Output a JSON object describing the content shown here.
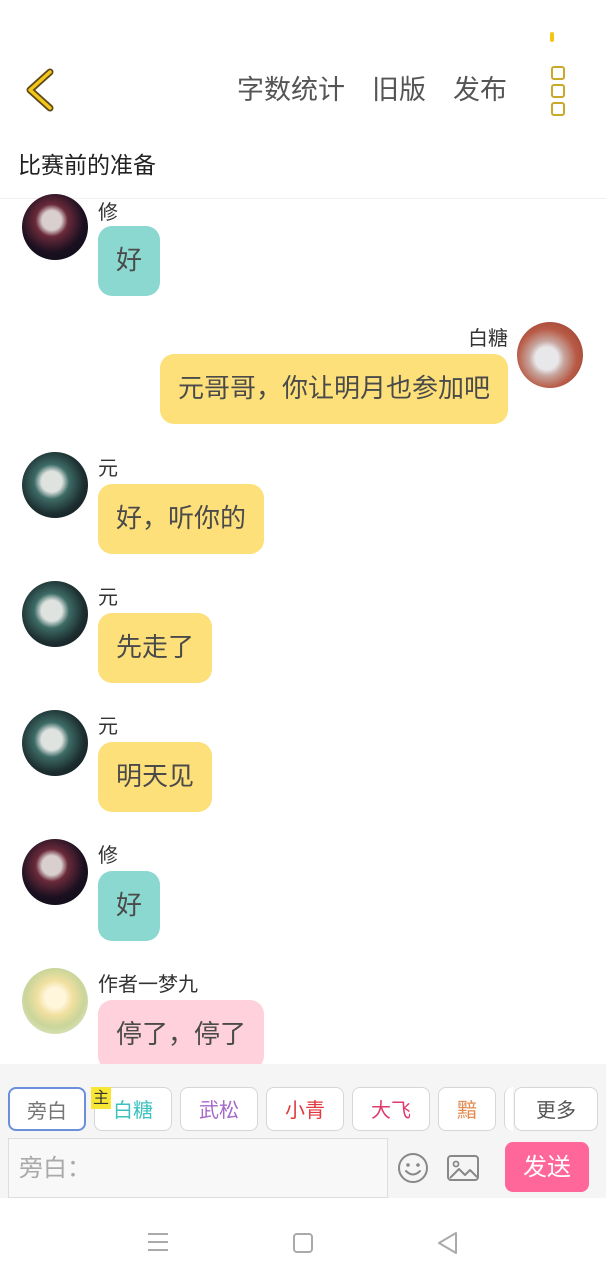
{
  "header": {
    "actions": [
      "字数统计",
      "旧版",
      "发布"
    ],
    "title": "比赛前的准备"
  },
  "messages": [
    {
      "side": "left",
      "name": "修",
      "text": "好",
      "color": "teal"
    },
    {
      "side": "right",
      "name": "白糖",
      "text": "元哥哥，你让明月也参加吧",
      "color": "yellow"
    },
    {
      "side": "left",
      "name": "元",
      "text": "好，听你的",
      "color": "yellow"
    },
    {
      "side": "left",
      "name": "元",
      "text": "先走了",
      "color": "yellow"
    },
    {
      "side": "left",
      "name": "元",
      "text": "明天见",
      "color": "yellow"
    },
    {
      "side": "left",
      "name": "修",
      "text": "好",
      "color": "teal"
    },
    {
      "side": "left",
      "name": "作者一梦九",
      "text": "停了，停了",
      "color": "pink"
    }
  ],
  "character_tabs": [
    {
      "label": "旁白",
      "color": "#777777",
      "selected": true
    },
    {
      "label": "白糖",
      "color": "#3cc2bf",
      "badge": "主"
    },
    {
      "label": "武松",
      "color": "#a569c8"
    },
    {
      "label": "小青",
      "color": "#e0393e"
    },
    {
      "label": "大飞",
      "color": "#e03a6d"
    },
    {
      "label": "黯",
      "color": "#e28a4f"
    }
  ],
  "more_label": "更多",
  "input": {
    "placeholder": "旁白："
  },
  "send_label": "发送",
  "icons": {
    "back": "chevron-left-icon",
    "menu": "more-vertical-icon",
    "emoji": "smiley-icon",
    "image": "image-icon",
    "nav": [
      "menu-lines-icon",
      "square-icon",
      "triangle-back-icon"
    ]
  },
  "colors": {
    "accent_yellow": "#fde07a",
    "teal": "#8ad8cf",
    "pink": "#ffd1dc",
    "send": "#ff6699"
  }
}
